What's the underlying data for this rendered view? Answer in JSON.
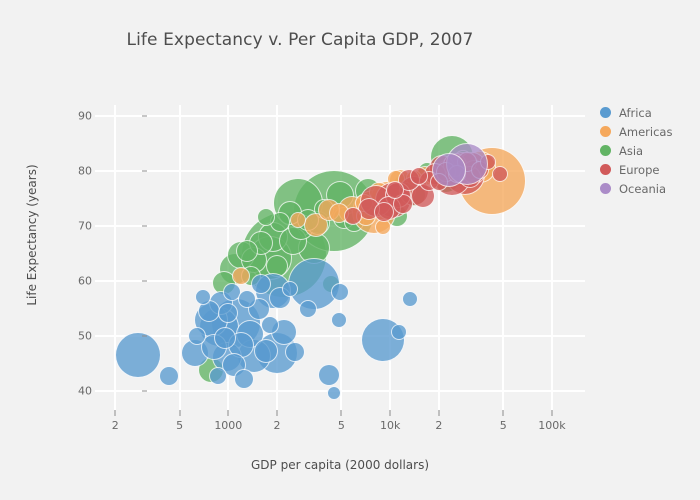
{
  "chart_data": {
    "type": "scatter",
    "title": "Life Expectancy v. Per Capita GDP, 2007",
    "xlabel": "GDP per capita (2000 dollars)",
    "ylabel": "Life Expectancy (years)",
    "xscale": "log",
    "xlim": [
      150,
      160000
    ],
    "ylim": [
      36.5,
      92
    ],
    "grid": true,
    "legend_position": "right",
    "x_tick_labels": [
      "2",
      "5",
      "1000",
      "2",
      "5",
      "10k",
      "2",
      "5",
      "100k"
    ],
    "x_tick_values": [
      200,
      500,
      1000,
      2000,
      5000,
      10000,
      20000,
      50000,
      100000
    ],
    "y_tick_labels": [
      "40",
      "50",
      "60",
      "70",
      "80",
      "90"
    ],
    "y_tick_values": [
      40,
      50,
      60,
      70,
      80,
      90
    ],
    "size_encoding": "population",
    "color_encoding": "continent",
    "series": [
      {
        "name": "Africa",
        "color": "#5a9bd0",
        "points": [
          {
            "x": 278,
            "y": 46.5,
            "r": 23
          },
          {
            "x": 430,
            "y": 42.7,
            "r": 10
          },
          {
            "x": 620,
            "y": 46.9,
            "r": 14
          },
          {
            "x": 640,
            "y": 50.0,
            "r": 9
          },
          {
            "x": 700,
            "y": 57.0,
            "r": 8
          },
          {
            "x": 760,
            "y": 54.5,
            "r": 11
          },
          {
            "x": 780,
            "y": 52.9,
            "r": 17
          },
          {
            "x": 820,
            "y": 48.0,
            "r": 13
          },
          {
            "x": 860,
            "y": 42.6,
            "r": 9
          },
          {
            "x": 880,
            "y": 51.6,
            "r": 20
          },
          {
            "x": 900,
            "y": 56.0,
            "r": 12
          },
          {
            "x": 960,
            "y": 49.6,
            "r": 11
          },
          {
            "x": 980,
            "y": 46.2,
            "r": 15
          },
          {
            "x": 1000,
            "y": 54.1,
            "r": 10
          },
          {
            "x": 1050,
            "y": 58.0,
            "r": 9
          },
          {
            "x": 1090,
            "y": 44.7,
            "r": 12
          },
          {
            "x": 1120,
            "y": 52.3,
            "r": 25
          },
          {
            "x": 1200,
            "y": 48.3,
            "r": 13
          },
          {
            "x": 1250,
            "y": 42.1,
            "r": 10
          },
          {
            "x": 1300,
            "y": 56.7,
            "r": 9
          },
          {
            "x": 1370,
            "y": 50.4,
            "r": 14
          },
          {
            "x": 1440,
            "y": 46.4,
            "r": 17
          },
          {
            "x": 1540,
            "y": 54.8,
            "r": 11
          },
          {
            "x": 1600,
            "y": 59.4,
            "r": 10
          },
          {
            "x": 1700,
            "y": 47.2,
            "r": 12
          },
          {
            "x": 1800,
            "y": 52.0,
            "r": 9
          },
          {
            "x": 1900,
            "y": 58.1,
            "r": 18
          },
          {
            "x": 2000,
            "y": 46.9,
            "r": 21
          },
          {
            "x": 2100,
            "y": 56.8,
            "r": 11
          },
          {
            "x": 2200,
            "y": 50.7,
            "r": 13
          },
          {
            "x": 2400,
            "y": 58.6,
            "r": 8
          },
          {
            "x": 2600,
            "y": 47.1,
            "r": 10
          },
          {
            "x": 3100,
            "y": 54.9,
            "r": 9
          },
          {
            "x": 3400,
            "y": 59.4,
            "r": 26
          },
          {
            "x": 4200,
            "y": 42.9,
            "r": 11
          },
          {
            "x": 4500,
            "y": 39.6,
            "r": 7
          },
          {
            "x": 4800,
            "y": 52.9,
            "r": 8
          },
          {
            "x": 4900,
            "y": 58.0,
            "r": 9
          },
          {
            "x": 9000,
            "y": 49.3,
            "r": 22
          },
          {
            "x": 11300,
            "y": 50.7,
            "r": 8
          },
          {
            "x": 13200,
            "y": 56.7,
            "r": 8
          }
        ]
      },
      {
        "name": "Americas",
        "color": "#f5a85c",
        "points": [
          {
            "x": 1200,
            "y": 60.9,
            "r": 9
          },
          {
            "x": 2700,
            "y": 71.0,
            "r": 8
          },
          {
            "x": 3500,
            "y": 70.2,
            "r": 12
          },
          {
            "x": 4200,
            "y": 72.9,
            "r": 11
          },
          {
            "x": 4800,
            "y": 72.4,
            "r": 10
          },
          {
            "x": 5800,
            "y": 72.9,
            "r": 14
          },
          {
            "x": 6900,
            "y": 74.2,
            "r": 9
          },
          {
            "x": 7100,
            "y": 71.8,
            "r": 10
          },
          {
            "x": 8000,
            "y": 72.5,
            "r": 22
          },
          {
            "x": 8500,
            "y": 76.2,
            "r": 10
          },
          {
            "x": 9000,
            "y": 69.8,
            "r": 8
          },
          {
            "x": 9600,
            "y": 75.3,
            "r": 16
          },
          {
            "x": 10900,
            "y": 78.6,
            "r": 9
          },
          {
            "x": 11500,
            "y": 78.3,
            "r": 11
          },
          {
            "x": 12800,
            "y": 76.4,
            "r": 9
          },
          {
            "x": 14000,
            "y": 78.8,
            "r": 8
          },
          {
            "x": 16500,
            "y": 79.0,
            "r": 10
          },
          {
            "x": 36000,
            "y": 80.7,
            "r": 16
          },
          {
            "x": 42900,
            "y": 78.2,
            "r": 34
          }
        ]
      },
      {
        "name": "Asia",
        "color": "#62b465",
        "points": [
          {
            "x": 780,
            "y": 43.8,
            "r": 13
          },
          {
            "x": 940,
            "y": 59.7,
            "r": 12
          },
          {
            "x": 1100,
            "y": 62.1,
            "r": 16
          },
          {
            "x": 1200,
            "y": 64.7,
            "r": 14
          },
          {
            "x": 1300,
            "y": 65.5,
            "r": 11
          },
          {
            "x": 1390,
            "y": 60.9,
            "r": 10
          },
          {
            "x": 1450,
            "y": 63.8,
            "r": 13
          },
          {
            "x": 1600,
            "y": 66.8,
            "r": 12
          },
          {
            "x": 1700,
            "y": 71.7,
            "r": 9
          },
          {
            "x": 1800,
            "y": 64.1,
            "r": 22
          },
          {
            "x": 1900,
            "y": 68.0,
            "r": 15
          },
          {
            "x": 2000,
            "y": 62.7,
            "r": 11
          },
          {
            "x": 2100,
            "y": 70.7,
            "r": 10
          },
          {
            "x": 2200,
            "y": 64.7,
            "r": 43
          },
          {
            "x": 2400,
            "y": 72.4,
            "r": 12
          },
          {
            "x": 2500,
            "y": 67.3,
            "r": 14
          },
          {
            "x": 2700,
            "y": 74.1,
            "r": 25
          },
          {
            "x": 2800,
            "y": 69.8,
            "r": 13
          },
          {
            "x": 3100,
            "y": 71.0,
            "r": 11
          },
          {
            "x": 3400,
            "y": 66.0,
            "r": 16
          },
          {
            "x": 3600,
            "y": 70.6,
            "r": 12
          },
          {
            "x": 3900,
            "y": 73.0,
            "r": 10
          },
          {
            "x": 4300,
            "y": 59.5,
            "r": 9
          },
          {
            "x": 4500,
            "y": 72.8,
            "r": 41
          },
          {
            "x": 4900,
            "y": 75.6,
            "r": 14
          },
          {
            "x": 5200,
            "y": 71.4,
            "r": 11
          },
          {
            "x": 6000,
            "y": 70.7,
            "r": 10
          },
          {
            "x": 7300,
            "y": 76.4,
            "r": 13
          },
          {
            "x": 8500,
            "y": 73.9,
            "r": 12
          },
          {
            "x": 9700,
            "y": 75.6,
            "r": 9
          },
          {
            "x": 11000,
            "y": 71.8,
            "r": 11
          },
          {
            "x": 12000,
            "y": 77.6,
            "r": 10
          },
          {
            "x": 14000,
            "y": 75.7,
            "r": 12
          },
          {
            "x": 17000,
            "y": 80.0,
            "r": 9
          },
          {
            "x": 22000,
            "y": 78.6,
            "r": 14
          },
          {
            "x": 24000,
            "y": 82.6,
            "r": 22
          },
          {
            "x": 28000,
            "y": 82.2,
            "r": 9
          },
          {
            "x": 31000,
            "y": 80.0,
            "r": 8
          },
          {
            "x": 40000,
            "y": 80.2,
            "r": 8
          }
        ]
      },
      {
        "name": "Europe",
        "color": "#d15a5a",
        "points": [
          {
            "x": 5900,
            "y": 71.8,
            "r": 9
          },
          {
            "x": 7400,
            "y": 73.0,
            "r": 11
          },
          {
            "x": 8200,
            "y": 74.5,
            "r": 16
          },
          {
            "x": 9200,
            "y": 72.5,
            "r": 10
          },
          {
            "x": 9800,
            "y": 73.3,
            "r": 12
          },
          {
            "x": 10400,
            "y": 74.8,
            "r": 18
          },
          {
            "x": 10700,
            "y": 76.5,
            "r": 9
          },
          {
            "x": 11200,
            "y": 75.6,
            "r": 13
          },
          {
            "x": 12000,
            "y": 74.0,
            "r": 10
          },
          {
            "x": 13000,
            "y": 78.3,
            "r": 11
          },
          {
            "x": 14000,
            "y": 76.4,
            "r": 15
          },
          {
            "x": 15000,
            "y": 79.0,
            "r": 9
          },
          {
            "x": 16000,
            "y": 75.5,
            "r": 12
          },
          {
            "x": 17500,
            "y": 78.1,
            "r": 10
          },
          {
            "x": 19000,
            "y": 79.4,
            "r": 11
          },
          {
            "x": 20000,
            "y": 77.9,
            "r": 9
          },
          {
            "x": 21000,
            "y": 80.5,
            "r": 13
          },
          {
            "x": 22000,
            "y": 79.8,
            "r": 10
          },
          {
            "x": 24000,
            "y": 78.9,
            "r": 19
          },
          {
            "x": 25000,
            "y": 81.0,
            "r": 12
          },
          {
            "x": 26000,
            "y": 79.4,
            "r": 9
          },
          {
            "x": 28000,
            "y": 80.6,
            "r": 16
          },
          {
            "x": 29000,
            "y": 79.3,
            "r": 20
          },
          {
            "x": 30000,
            "y": 81.7,
            "r": 10
          },
          {
            "x": 31000,
            "y": 78.9,
            "r": 11
          },
          {
            "x": 32000,
            "y": 80.9,
            "r": 14
          },
          {
            "x": 33000,
            "y": 79.8,
            "r": 12
          },
          {
            "x": 36000,
            "y": 80.2,
            "r": 9
          },
          {
            "x": 40000,
            "y": 81.7,
            "r": 8
          },
          {
            "x": 48000,
            "y": 79.4,
            "r": 8
          }
        ]
      },
      {
        "name": "Oceania",
        "color": "#ab8cc8",
        "points": [
          {
            "x": 23000,
            "y": 80.2,
            "r": 17
          },
          {
            "x": 30000,
            "y": 81.2,
            "r": 21
          }
        ]
      }
    ]
  },
  "legend": {
    "items": [
      {
        "label": "Africa",
        "color": "#5a9bd0"
      },
      {
        "label": "Americas",
        "color": "#f5a85c"
      },
      {
        "label": "Asia",
        "color": "#62b465"
      },
      {
        "label": "Europe",
        "color": "#d15a5a"
      },
      {
        "label": "Oceania",
        "color": "#ab8cc8"
      }
    ]
  }
}
